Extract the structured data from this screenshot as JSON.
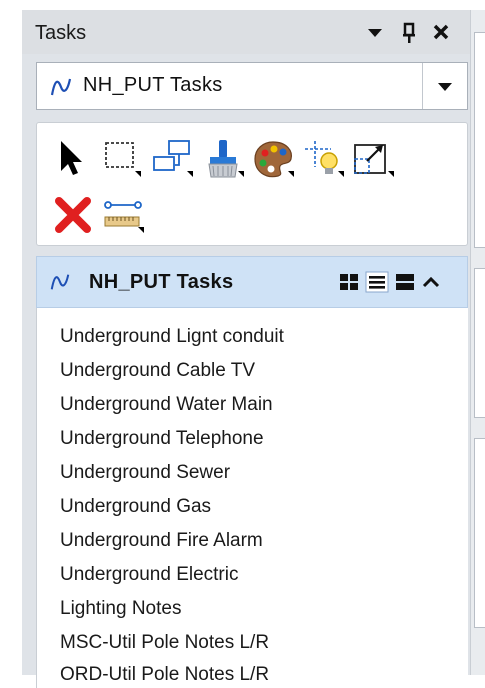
{
  "panel": {
    "title": "Tasks",
    "buttons": [
      {
        "icon": "dropdown-arrow-icon",
        "glyph": "▼"
      },
      {
        "icon": "pin-icon",
        "glyph": "ᵻ"
      },
      {
        "icon": "close-icon",
        "glyph": "✕"
      }
    ]
  },
  "dropdown": {
    "selected": "NH_PUT Tasks",
    "icon": "task-curve-icon"
  },
  "toolbox": {
    "tools": [
      {
        "name": "select-element-icon"
      },
      {
        "name": "selection-rectangle-icon"
      },
      {
        "name": "move-copy-icon"
      },
      {
        "name": "paint-brush-icon"
      },
      {
        "name": "palette-icon"
      },
      {
        "name": "light-bulb-icon"
      },
      {
        "name": "scale-icon"
      },
      {
        "name": "delete-icon"
      },
      {
        "name": "measure-icon"
      }
    ]
  },
  "group": {
    "title": "NH_PUT Tasks",
    "icon": "task-curve-icon",
    "view_buttons": [
      "icon-view-icon",
      "list-view-icon",
      "detail-view-icon",
      "collapse-icon"
    ]
  },
  "tasks": [
    "Underground Lignt conduit",
    "Underground Cable TV",
    "Underground Water Main",
    "Underground Telephone",
    "Underground Sewer",
    "Underground Gas",
    "Underground Fire Alarm",
    "Underground Electric",
    "Lighting Notes",
    "MSC-Util Pole Notes L/R",
    "ORD-Util Pole Notes L/R"
  ],
  "colors": {
    "panel_bg": "#dfe3e8",
    "header_bg": "#cfe2f6",
    "delete_red": "#e02020",
    "accent_blue": "#1e66c8"
  }
}
